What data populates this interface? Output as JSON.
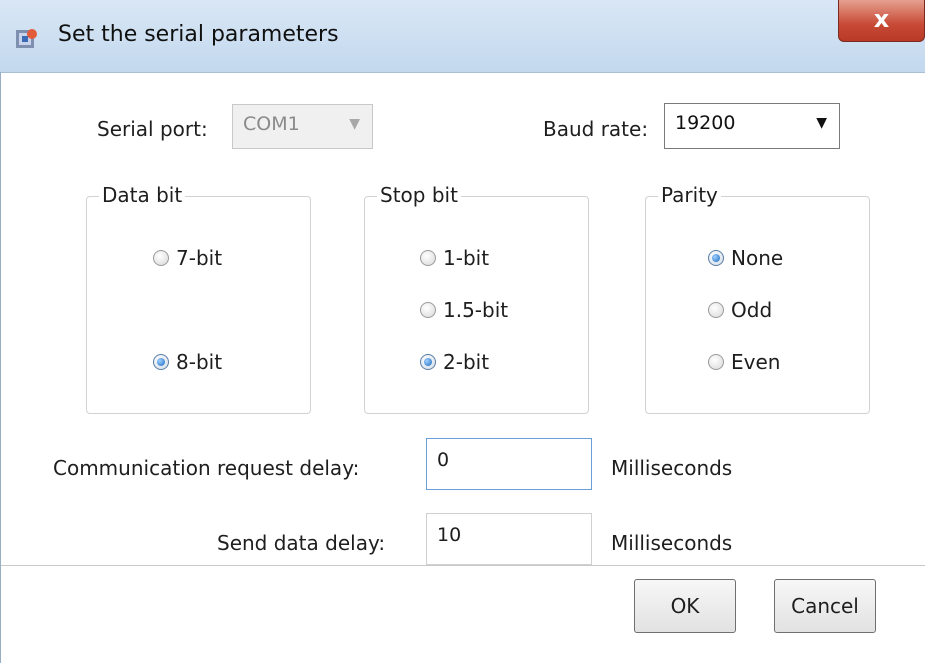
{
  "window": {
    "title": "Set the serial parameters",
    "close_symbol": "x"
  },
  "serial_port": {
    "label": "Serial port:",
    "value": "COM1",
    "enabled": false
  },
  "baud_rate": {
    "label": "Baud rate:",
    "value": "19200"
  },
  "groups": {
    "data_bit": {
      "title": "Data bit",
      "options": [
        {
          "label": "7-bit",
          "checked": false
        },
        {
          "label": "8-bit",
          "checked": true
        }
      ]
    },
    "stop_bit": {
      "title": "Stop bit",
      "options": [
        {
          "label": "1-bit",
          "checked": false
        },
        {
          "label": "1.5-bit",
          "checked": false
        },
        {
          "label": "2-bit",
          "checked": true
        }
      ]
    },
    "parity": {
      "title": "Parity",
      "options": [
        {
          "label": "None",
          "checked": true
        },
        {
          "label": "Odd",
          "checked": false
        },
        {
          "label": "Even",
          "checked": false
        }
      ]
    }
  },
  "comm_delay": {
    "label": "Communication request delay:",
    "value": "0",
    "unit": "Milliseconds"
  },
  "send_delay": {
    "label": "Send data delay:",
    "value": "10",
    "unit": "Milliseconds"
  },
  "buttons": {
    "ok": "OK",
    "cancel": "Cancel"
  },
  "colors": {
    "titlebar": "#c3d8ee",
    "close": "#c74a35",
    "focus_border": "#6a9ed8",
    "radio_checked": "#1c6bc0"
  }
}
